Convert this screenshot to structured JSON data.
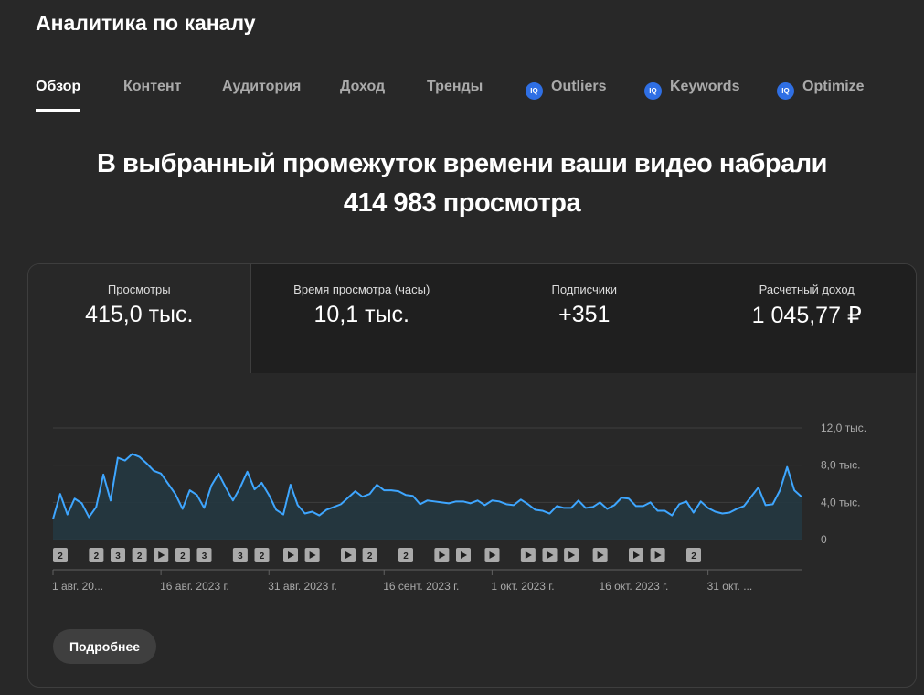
{
  "page": {
    "title": "Аналитика по каналу"
  },
  "tabs": [
    {
      "label": "Обзор",
      "active": true
    },
    {
      "label": "Контент"
    },
    {
      "label": "Аудитория"
    },
    {
      "label": "Доход"
    },
    {
      "label": "Тренды"
    },
    {
      "label": "Outliers",
      "icon": "vidiq-icon",
      "icon_text": "IQ"
    },
    {
      "label": "Keywords",
      "icon": "vidiq-icon",
      "icon_text": "IQ"
    },
    {
      "label": "Optimize",
      "icon": "vidiq-icon",
      "icon_text": "IQ"
    }
  ],
  "headline": {
    "line1": "В выбранный промежуток времени ваши видео набрали",
    "line2": "414 983 просмотра"
  },
  "metrics": [
    {
      "label": "Просмотры",
      "value": "415,0 тыс."
    },
    {
      "label": "Время просмотра (часы)",
      "value": "10,1 тыс."
    },
    {
      "label": "Подписчики",
      "value": "+351"
    },
    {
      "label": "Расчетный доход",
      "value": "1 045,77 ₽"
    }
  ],
  "chart_data": {
    "type": "area",
    "series": [
      {
        "values": [
          2.2,
          4.9,
          2.7,
          4.4,
          3.9,
          2.4,
          3.5,
          7.0,
          4.2,
          8.8,
          8.5,
          9.2,
          8.9,
          8.2,
          7.4,
          7.1,
          6.0,
          4.9,
          3.3,
          5.3,
          4.8,
          3.4,
          5.8,
          7.1,
          5.6,
          4.2,
          5.6,
          7.3,
          5.4,
          6.1,
          4.8,
          3.2,
          2.7,
          5.9,
          3.7,
          2.8,
          3.0,
          2.6,
          3.2,
          3.5,
          3.8,
          4.5,
          5.2,
          4.6,
          4.9,
          5.9,
          5.3,
          5.3,
          5.2,
          4.8,
          4.7,
          3.8,
          4.2,
          4.1,
          4.0,
          3.9,
          4.1,
          4.1,
          3.9,
          4.2,
          3.7,
          4.2,
          4.1,
          3.8,
          3.7,
          4.3,
          3.8,
          3.2,
          3.1,
          2.8,
          3.6,
          3.4,
          3.4,
          4.2,
          3.4,
          3.5,
          4.0,
          3.3,
          3.7,
          4.5,
          4.4,
          3.6,
          3.6,
          4.0,
          3.1,
          3.1,
          2.6,
          3.8,
          4.1,
          2.9,
          4.1,
          3.4,
          3.0,
          2.8,
          2.9,
          3.3,
          3.6,
          4.6,
          5.6,
          3.7,
          3.8,
          5.3,
          7.8,
          5.3,
          4.6
        ]
      }
    ],
    "y_ticks": [
      "12,0 тыс.",
      "8,0 тыс.",
      "4,0 тыс.",
      "0"
    ],
    "ylim": [
      0,
      12000
    ],
    "x_ticks": [
      "1 авг. 20...",
      "16 авг. 2023 г.",
      "31 авг. 2023 г.",
      "16 сент. 2023 г.",
      "1 окт. 2023 г.",
      "16 окт. 2023 г.",
      "31 окт. ..."
    ],
    "markers": [
      {
        "day": 0,
        "kind": "count",
        "label": "2"
      },
      {
        "day": 5,
        "kind": "count",
        "label": "2"
      },
      {
        "day": 8,
        "kind": "count",
        "label": "3"
      },
      {
        "day": 11,
        "kind": "count",
        "label": "2"
      },
      {
        "day": 14,
        "kind": "play"
      },
      {
        "day": 17,
        "kind": "count",
        "label": "2"
      },
      {
        "day": 20,
        "kind": "count",
        "label": "3"
      },
      {
        "day": 25,
        "kind": "count",
        "label": "3"
      },
      {
        "day": 28,
        "kind": "count",
        "label": "2"
      },
      {
        "day": 32,
        "kind": "play"
      },
      {
        "day": 35,
        "kind": "play"
      },
      {
        "day": 40,
        "kind": "play"
      },
      {
        "day": 43,
        "kind": "count",
        "label": "2"
      },
      {
        "day": 48,
        "kind": "count",
        "label": "2"
      },
      {
        "day": 53,
        "kind": "play"
      },
      {
        "day": 56,
        "kind": "play"
      },
      {
        "day": 60,
        "kind": "play"
      },
      {
        "day": 65,
        "kind": "play"
      },
      {
        "day": 68,
        "kind": "play"
      },
      {
        "day": 71,
        "kind": "play"
      },
      {
        "day": 75,
        "kind": "play"
      },
      {
        "day": 80,
        "kind": "play"
      },
      {
        "day": 83,
        "kind": "play"
      },
      {
        "day": 88,
        "kind": "count",
        "label": "2"
      }
    ],
    "colors": {
      "line": "#3ea6ff",
      "fill": "#243740"
    }
  },
  "actions": {
    "more_label": "Подробнее"
  }
}
